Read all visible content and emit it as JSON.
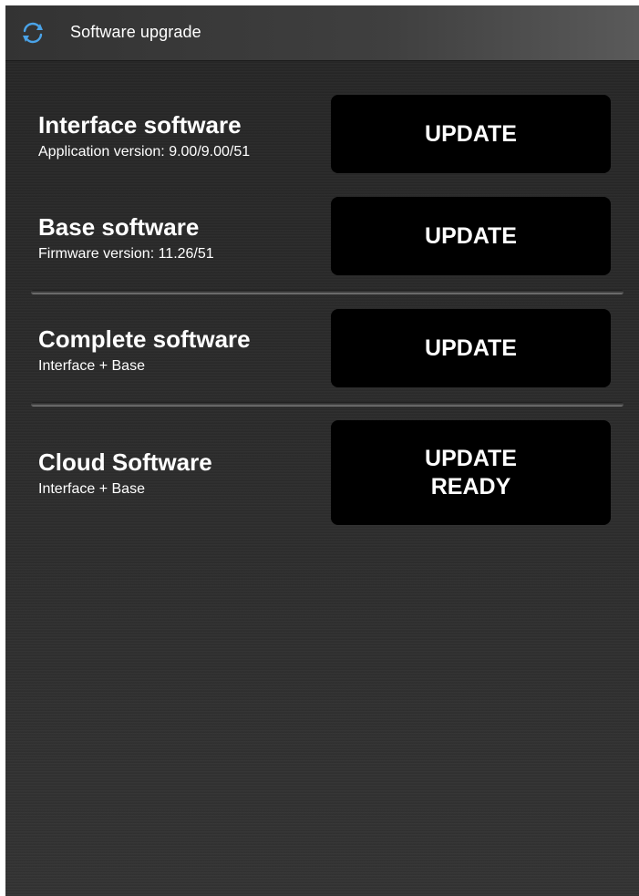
{
  "header": {
    "title": "Software upgrade",
    "icon": "refresh-icon",
    "icon_color": "#4aa3e8"
  },
  "items": [
    {
      "title": "Interface software",
      "subtitle": "Application version: 9.00/9.00/51",
      "button": "UPDATE"
    },
    {
      "title": "Base software",
      "subtitle": "Firmware version: 11.26/51",
      "button": "UPDATE"
    },
    {
      "title": "Complete software",
      "subtitle": "Interface + Base",
      "button": "UPDATE"
    },
    {
      "title": "Cloud Software",
      "subtitle": "Interface + Base",
      "button_line1": "UPDATE",
      "button_line2": "READY"
    }
  ]
}
